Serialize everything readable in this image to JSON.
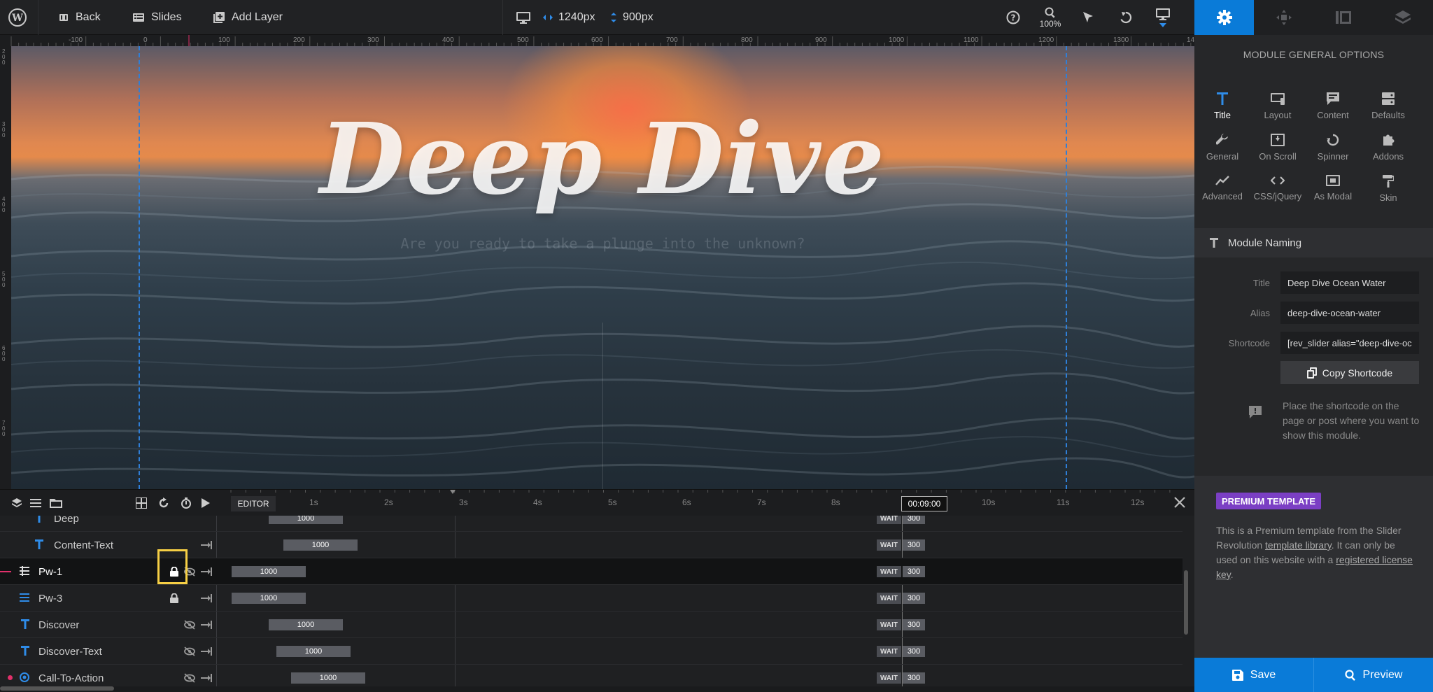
{
  "toolbar": {
    "back_label": "Back",
    "slides_label": "Slides",
    "add_layer_label": "Add Layer",
    "width_value": "1240px",
    "height_value": "900px",
    "zoom_value": "100%"
  },
  "ruler": {
    "h_labels": [
      "-100",
      "0",
      "100",
      "200",
      "300",
      "400",
      "500",
      "600",
      "700",
      "800",
      "900",
      "1000",
      "1100",
      "1200",
      "1300",
      "14"
    ],
    "v_labels": [
      "200",
      "300",
      "400",
      "500",
      "600",
      "700"
    ]
  },
  "canvas": {
    "title_text": "Deep Dive",
    "subtitle_text": "Are you ready to take a plunge into the unknown?"
  },
  "panel": {
    "header": "MODULE GENERAL OPTIONS",
    "options": [
      {
        "label": "Title",
        "icon": "title-icon",
        "active": true
      },
      {
        "label": "Layout",
        "icon": "layout-icon"
      },
      {
        "label": "Content",
        "icon": "content-icon"
      },
      {
        "label": "Defaults",
        "icon": "defaults-icon"
      },
      {
        "label": "General",
        "icon": "wrench-icon"
      },
      {
        "label": "On Scroll",
        "icon": "on-scroll-icon"
      },
      {
        "label": "Spinner",
        "icon": "spinner-icon"
      },
      {
        "label": "Addons",
        "icon": "puzzle-icon"
      },
      {
        "label": "Advanced",
        "icon": "chart-line-icon"
      },
      {
        "label": "CSS/jQuery",
        "icon": "code-icon"
      },
      {
        "label": "As Modal",
        "icon": "modal-icon"
      },
      {
        "label": "Skin",
        "icon": "paint-roller-icon"
      }
    ],
    "naming_header": "Module Naming",
    "title_label": "Title",
    "title_value": "Deep Dive Ocean Water",
    "alias_label": "Alias",
    "alias_value": "deep-dive-ocean-water",
    "shortcode_label": "Shortcode",
    "shortcode_value": "[rev_slider alias=\"deep-dive-ocean-water\"]",
    "copy_button": "Copy Shortcode",
    "hint": "Place the shortcode on the page or post where you want to show this module.",
    "premium_badge": "PREMIUM TEMPLATE",
    "premium_text_1": "This is a Premium template from the Slider Revolution ",
    "premium_link_1": "template library",
    "premium_text_2": ". It can only be used on this website with a ",
    "premium_link_2": "registered license key",
    "premium_text_3": ".",
    "save_label": "Save",
    "preview_label": "Preview"
  },
  "timeline": {
    "editor_tab": "EDITOR",
    "ticks": [
      "1s",
      "2s",
      "3s",
      "4s",
      "5s",
      "6s",
      "7s",
      "8s",
      "9s",
      "10s",
      "11s",
      "12s"
    ],
    "current_time": "00:09:00",
    "wait_label": "WAIT",
    "rows": [
      {
        "name": "Deep",
        "bar": "1000",
        "wait": "300"
      },
      {
        "name": "Content-Text",
        "bar": "1000",
        "wait": "300"
      },
      {
        "name": "Pw-1",
        "bar": "1000",
        "wait": "300"
      },
      {
        "name": "Pw-3",
        "bar": "1000",
        "wait": "300"
      },
      {
        "name": "Discover",
        "bar": "1000",
        "wait": "300"
      },
      {
        "name": "Discover-Text",
        "bar": "1000",
        "wait": "300"
      },
      {
        "name": "Call-To-Action",
        "bar": "1000",
        "wait": "300"
      }
    ]
  },
  "colors": {
    "accent": "#0a7bd8",
    "premium": "#7b3fc4",
    "highlight": "#f6cf45"
  }
}
